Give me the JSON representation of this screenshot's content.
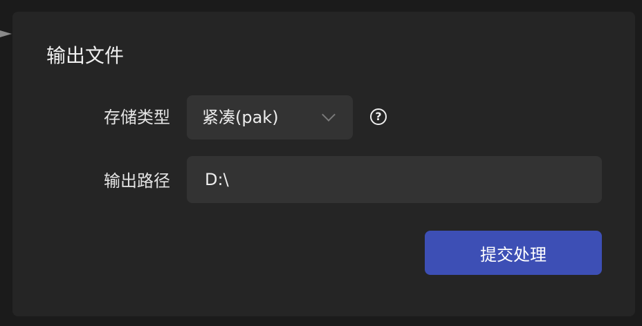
{
  "panel": {
    "title": "输出文件"
  },
  "storage": {
    "label": "存储类型",
    "selected": "紧凑(pak)"
  },
  "output": {
    "label": "输出路径",
    "value": "D:\\"
  },
  "actions": {
    "submit_label": "提交处理"
  },
  "icons": {
    "help": "question-circle-icon",
    "dropdown": "chevron-down-icon",
    "collapse": "triangle-right-icon"
  },
  "colors": {
    "background": "#1b1b1b",
    "panel": "#252525",
    "field": "#333333",
    "accent": "#3d4fb5"
  }
}
